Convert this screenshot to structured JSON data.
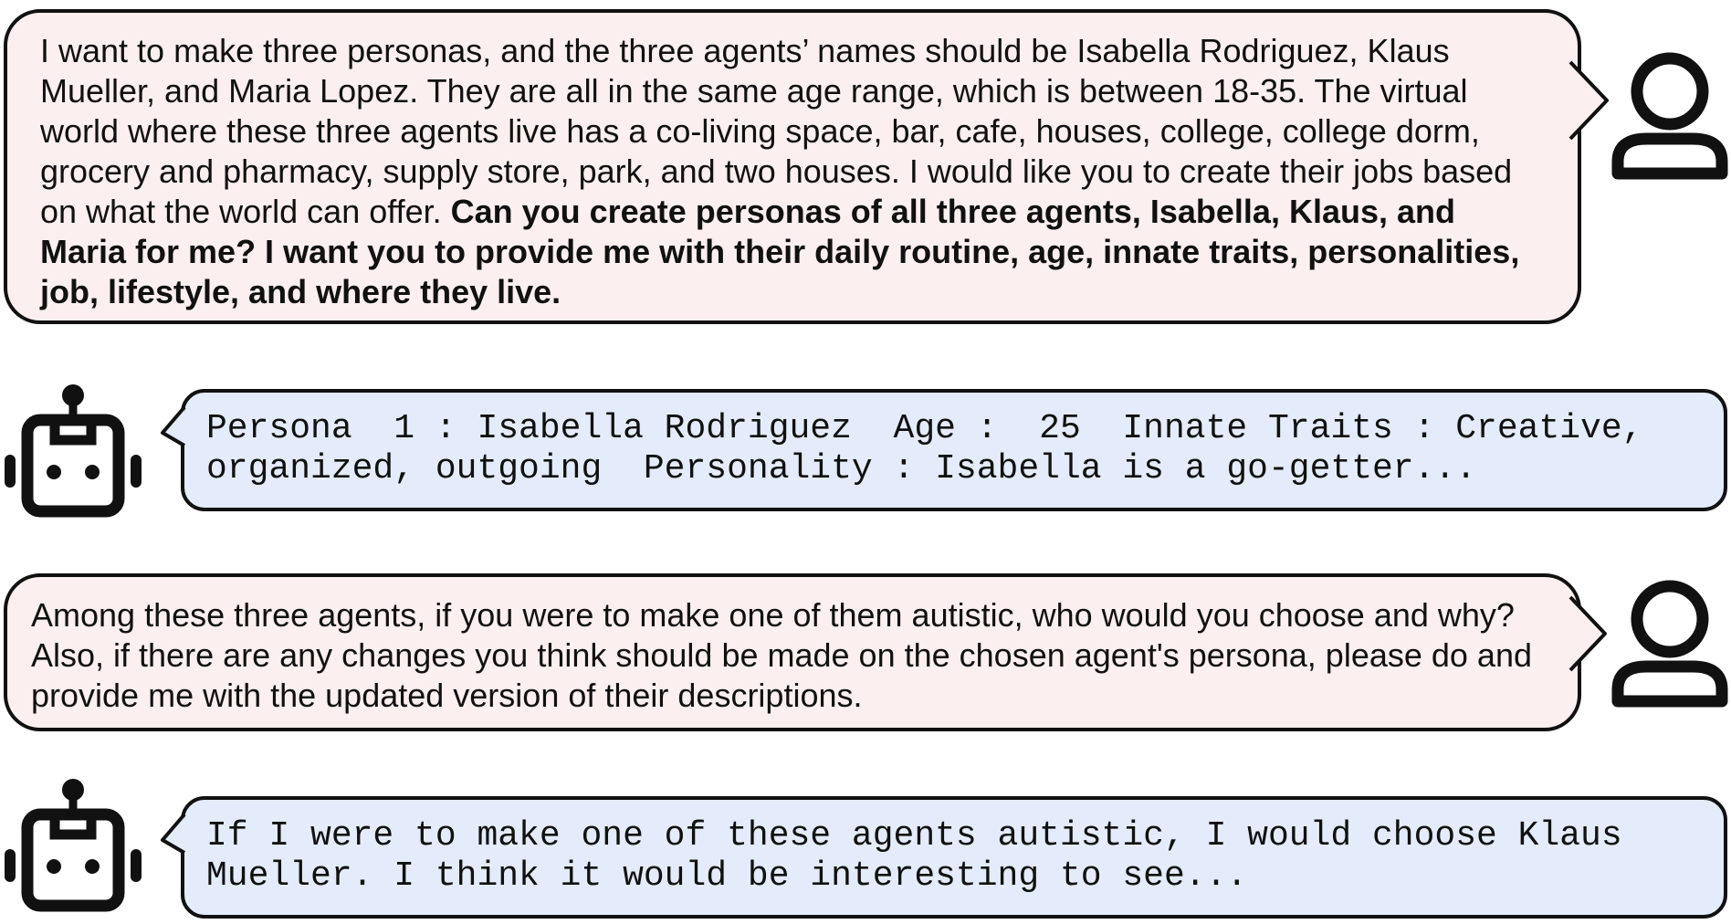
{
  "messages": [
    {
      "role": "user",
      "text": "I want to make three personas, and the three agents’ names should be Isabella Rodriguez, Klaus Mueller, and Maria Lopez. They are all in the same age range, which is between 18-35. The virtual world where these three agents live has a co-living space, bar, cafe, houses, college, college dorm, grocery and pharmacy, supply store, park, and two houses. I would like you to create their jobs based on what the world can offer. ",
      "bold_text": "Can you create personas of all three agents, Isabella, Klaus, and Maria for me? I want you to provide me with their daily routine, age, innate traits, personalities, job, lifestyle, and where they live.",
      "icon": "user-person-icon"
    },
    {
      "role": "assistant",
      "text": "Persona  1 : Isabella Rodriguez  Age :  25  Innate Traits : Creative, organized, outgoing  Personality : Isabella is a go-getter...",
      "icon": "robot-icon"
    },
    {
      "role": "user",
      "text": "Among these three agents, if you were to make one of them autistic, who would you choose and why? Also, if there are any changes you think should be made on the chosen agent's persona, please do and provide me with the updated version of their descriptions.",
      "icon": "user-person-icon"
    },
    {
      "role": "assistant",
      "text": "If I were to make one of these agents autistic, I would choose Klaus Mueller. I think it would be interesting to see...",
      "icon": "robot-icon"
    }
  ]
}
